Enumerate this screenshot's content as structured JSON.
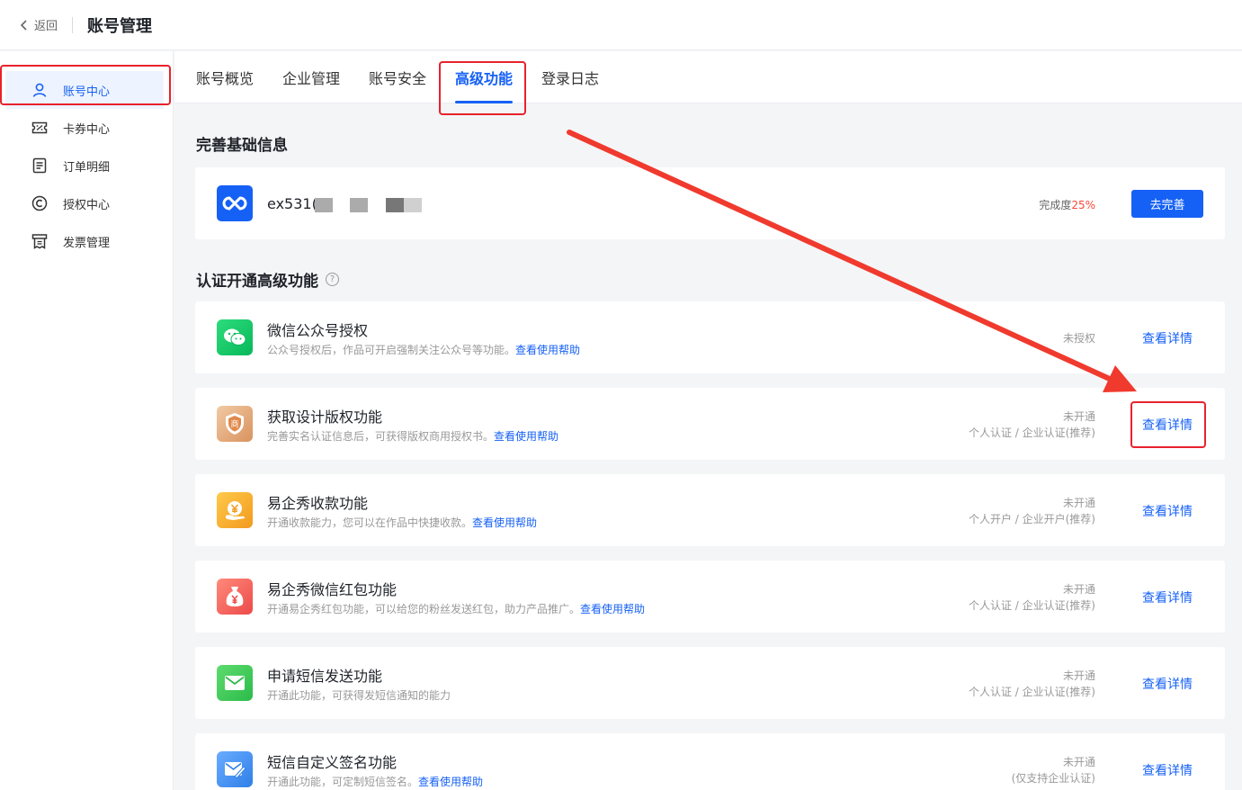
{
  "header": {
    "back_label": "返回",
    "title": "账号管理"
  },
  "sidebar": {
    "items": [
      {
        "label": "账号中心",
        "icon": "user-icon"
      },
      {
        "label": "卡券中心",
        "icon": "coupon-icon"
      },
      {
        "label": "订单明细",
        "icon": "order-icon"
      },
      {
        "label": "授权中心",
        "icon": "copyright-icon"
      },
      {
        "label": "发票管理",
        "icon": "invoice-icon"
      }
    ],
    "active_index": 0
  },
  "tabs": {
    "items": [
      "账号概览",
      "企业管理",
      "账号安全",
      "高级功能",
      "登录日志"
    ],
    "active_index": 3
  },
  "basic_info": {
    "section_title": "完善基础信息",
    "username": "ex531(",
    "progress_label": "完成度",
    "progress_value": "25%",
    "complete_button": "去完善"
  },
  "advanced": {
    "section_title": "认证开通高级功能",
    "help_glyph": "?",
    "features": [
      {
        "name": "微信公众号授权",
        "desc": "公众号授权后，作品可开启强制关注公众号等功能。",
        "help_link": "查看使用帮助",
        "status": "未授权",
        "requirement": "",
        "detail": "查看详情",
        "icon_color": "#07c160"
      },
      {
        "name": "获取设计版权功能",
        "desc": "完善实名认证信息后，可获得版权商用授权书。",
        "help_link": "查看使用帮助",
        "status": "未开通",
        "requirement": "个人认证 / 企业认证(推荐)",
        "detail": "查看详情",
        "icon_color": "#e9a66b",
        "icon_glyph": "商"
      },
      {
        "name": "易企秀收款功能",
        "desc": "开通收款能力，您可以在作品中快捷收款。",
        "help_link": "查看使用帮助",
        "status": "未开通",
        "requirement": "个人开户 / 企业开户(推荐)",
        "detail": "查看详情",
        "icon_color": "#f5a623"
      },
      {
        "name": "易企秀微信红包功能",
        "desc": "开通易企秀红包功能，可以给您的粉丝发送红包，助力产品推广。",
        "help_link": "查看使用帮助",
        "status": "未开通",
        "requirement": "个人认证 / 企业认证(推荐)",
        "detail": "查看详情",
        "icon_color": "#f05a5a"
      },
      {
        "name": "申请短信发送功能",
        "desc": "开通此功能，可获得发短信通知的能力",
        "help_link": "",
        "status": "未开通",
        "requirement": "个人认证 / 企业认证(推荐)",
        "detail": "查看详情",
        "icon_color": "#3ccb5a"
      },
      {
        "name": "短信自定义签名功能",
        "desc": "开通此功能，可定制短信签名。",
        "help_link": "查看使用帮助",
        "status": "未开通",
        "requirement": "(仅支持企业认证)",
        "detail": "查看详情",
        "icon_color": "#3b8cf0"
      }
    ]
  },
  "colors": {
    "accent": "#1661f5",
    "highlight": "#e8222c",
    "warning": "#f5483b"
  }
}
